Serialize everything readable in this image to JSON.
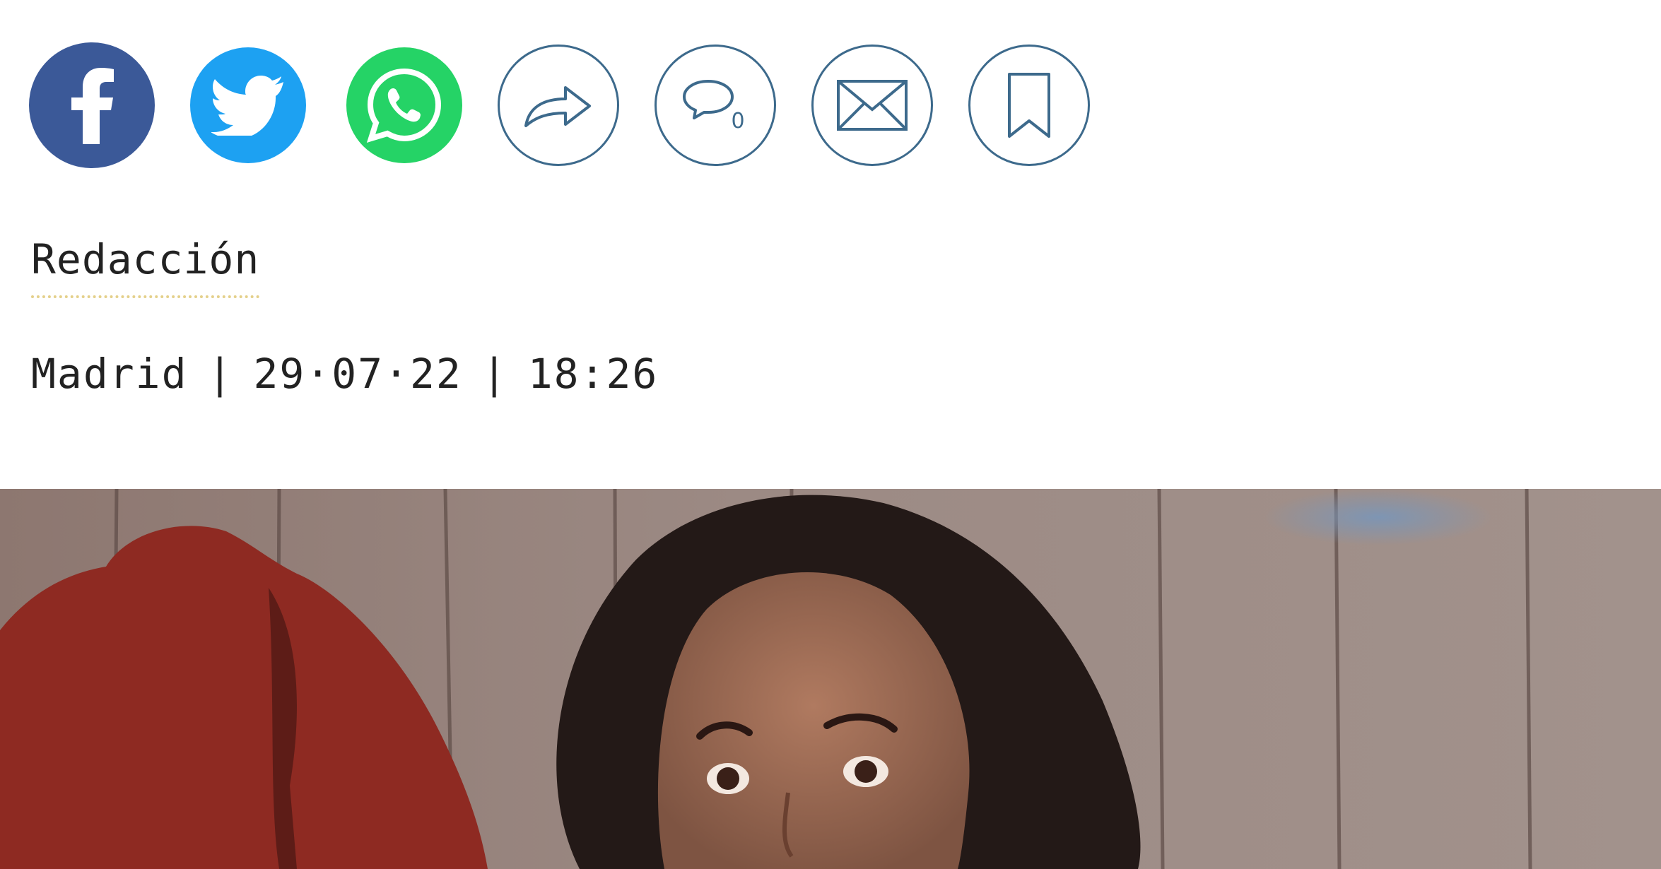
{
  "share_bar": {
    "buttons": [
      {
        "icon": "facebook-icon",
        "color": "#3b5998"
      },
      {
        "icon": "twitter-icon",
        "color": "#1da1f2"
      },
      {
        "icon": "whatsapp-icon",
        "color": "#25d366"
      },
      {
        "icon": "share-arrow-icon",
        "color": "#3d6a8c"
      },
      {
        "icon": "comment-icon",
        "color": "#3d6a8c",
        "count": "0"
      },
      {
        "icon": "mail-icon",
        "color": "#3d6a8c"
      },
      {
        "icon": "bookmark-icon",
        "color": "#3d6a8c"
      }
    ]
  },
  "article": {
    "author": "Redacción",
    "city": "Madrid",
    "separator": "|",
    "date": "29·07·22",
    "time": "18:26"
  },
  "colors": {
    "outline_accent": "#3d6a8c",
    "author_underline": "#e4d08a",
    "text": "#222222"
  }
}
